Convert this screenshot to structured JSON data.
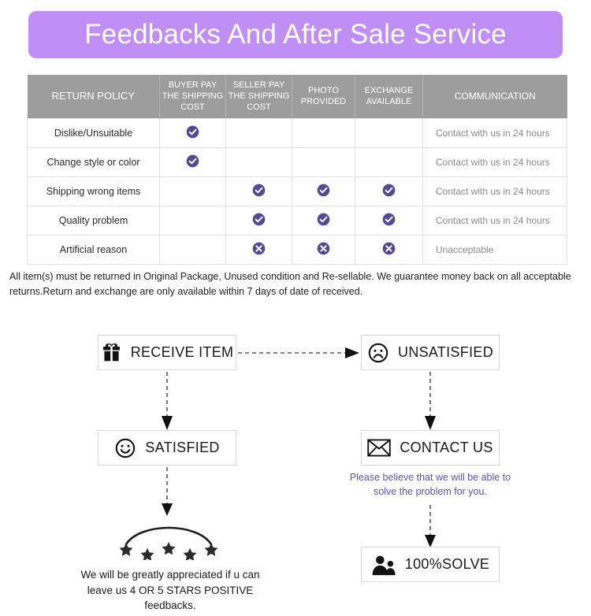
{
  "banner": {
    "title": "Feedbacks And After Sale Service",
    "background_color": "#bf8ff5",
    "text_color": "#ffffff"
  },
  "table": {
    "header_background": "#9d9d9d",
    "accent_color": "#554a8f",
    "headers": [
      "RETURN POLICY",
      "BUYER PAY THE SHIPPING COST",
      "SELLER PAY THE SHIPPING COST",
      "PHOTO PROVIDED",
      "EXCHANGE AVAILABLE",
      "COMMUNICATION"
    ],
    "headers_lines": {
      "col0": "RETURN POLICY",
      "col1_l1": "BUYER PAY",
      "col1_l2": "THE SHIPPING",
      "col1_l3": "COST",
      "col2_l1": "SELLER PAY",
      "col2_l2": "THE SHIPPING",
      "col2_l3": "COST",
      "col3_l1": "PHOTO",
      "col3_l2": "PROVIDED",
      "col4_l1": "EXCHANGE",
      "col4_l2": "AVAILABLE",
      "col5": "COMMUNICATION"
    },
    "rows": [
      {
        "policy": "Dislike/Unsuitable",
        "buyer_pay": "check",
        "seller_pay": "",
        "photo_provided": "",
        "exchange_available": "",
        "communication": "Contact with us in 24 hours"
      },
      {
        "policy": "Change style or color",
        "buyer_pay": "check",
        "seller_pay": "",
        "photo_provided": "",
        "exchange_available": "",
        "communication": "Contact with us in 24 hours"
      },
      {
        "policy": "Shipping wrong items",
        "buyer_pay": "",
        "seller_pay": "check",
        "photo_provided": "check",
        "exchange_available": "check",
        "communication": "Contact with us in 24 hours"
      },
      {
        "policy": "Quality problem",
        "buyer_pay": "",
        "seller_pay": "check",
        "photo_provided": "check",
        "exchange_available": "check",
        "communication": "Contact with us in 24 hours"
      },
      {
        "policy": "Artificial reason",
        "buyer_pay": "",
        "seller_pay": "cross",
        "photo_provided": "cross",
        "exchange_available": "cross",
        "communication": "Unacceptable"
      }
    ]
  },
  "note": "All item(s) must be returned in Original Package, Unused condition and Re-sellable. We guarantee money back on all acceptable returns.Return and exchange are only available within 7 days of date of received.",
  "flow": {
    "nodes": {
      "receive_item": {
        "label": "RECEIVE ITEM",
        "icon": "gift-icon"
      },
      "unsatisfied": {
        "label": "UNSATISFIED",
        "icon": "sad-face-icon"
      },
      "satisfied": {
        "label": "SATISFIED",
        "icon": "happy-face-icon"
      },
      "contact_us": {
        "label": "CONTACT US",
        "icon": "envelope-icon"
      },
      "solve": {
        "label": "100%SOLVE",
        "icon": "people-icon"
      }
    },
    "purple_note": "Please believe that we will be able to solve the problem for you.",
    "purple_note_color": "#5b55a8",
    "stars": {
      "count": 5,
      "icon": "star-icon",
      "color": "#2b2b2b"
    },
    "bottom_note": "We will be greatly appreciated if u can leave us 4 OR 5 STARS POSITIVE feedbacks."
  }
}
